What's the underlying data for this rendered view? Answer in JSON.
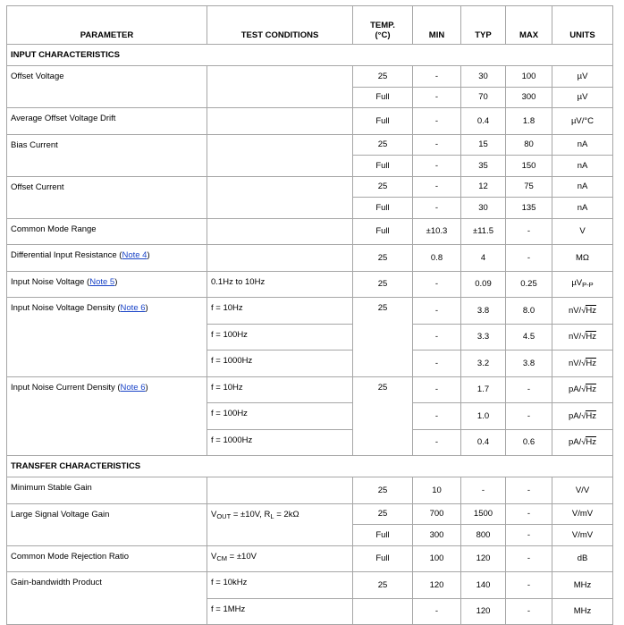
{
  "headers": {
    "parameter": "PARAMETER",
    "test_conditions": "TEST CONDITIONS",
    "temp_line1": "TEMP.",
    "temp_line2": "(°C)",
    "min": "MIN",
    "typ": "TYP",
    "max": "MAX",
    "units": "UNITS"
  },
  "sections": {
    "input": "INPUT CHARACTERISTICS",
    "transfer": "TRANSFER CHARACTERISTICS"
  },
  "params": {
    "offset_voltage": "Offset Voltage",
    "avg_offset_drift": "Average Offset Voltage Drift",
    "bias_current": "Bias Current",
    "offset_current": "Offset Current",
    "cm_range": "Common Mode Range",
    "diff_input_res": "Differential Input Resistance",
    "input_noise_voltage": "Input Noise Voltage",
    "input_noise_voltage_density": "Input Noise Voltage Density",
    "input_noise_current_density": "Input Noise Current Density",
    "min_stable_gain": "Minimum Stable Gain",
    "large_signal_gain": "Large Signal Voltage Gain",
    "cmrr": "Common Mode Rejection Ratio",
    "gbw": "Gain-bandwidth Product"
  },
  "notes": {
    "note4": "Note 4",
    "note5": "Note 5",
    "note6a": "Note 6",
    "note6b": "Note 6"
  },
  "conditions": {
    "noise_band": "0.1Hz to 10Hz",
    "f10": "f = 10Hz",
    "f100": "f = 100Hz",
    "f1000": "f = 1000Hz",
    "f10b": "f = 10Hz",
    "f100b": "f = 100Hz",
    "f1000b": "f = 1000Hz",
    "vout_pre": "V",
    "vout_sub": "OUT",
    "vout_post": " = ±10V, R",
    "rl_sub": "L",
    "rl_post": " = 2kΩ",
    "vcm_pre": "V",
    "vcm_sub": "CM",
    "vcm_post": " = ±10V",
    "f10k": "f = 10kHz",
    "f1M": "f = 1MHz"
  },
  "rows": {
    "ov1": {
      "temp": "25",
      "min": "-",
      "typ": "30",
      "max": "100",
      "unit": "µV"
    },
    "ov2": {
      "temp": "Full",
      "min": "-",
      "typ": "70",
      "max": "300",
      "unit": "µV"
    },
    "drift": {
      "temp": "Full",
      "min": "-",
      "typ": "0.4",
      "max": "1.8",
      "unit": "µV/°C"
    },
    "bc1": {
      "temp": "25",
      "min": "-",
      "typ": "15",
      "max": "80",
      "unit": "nA"
    },
    "bc2": {
      "temp": "Full",
      "min": "-",
      "typ": "35",
      "max": "150",
      "unit": "nA"
    },
    "oc1": {
      "temp": "25",
      "min": "-",
      "typ": "12",
      "max": "75",
      "unit": "nA"
    },
    "oc2": {
      "temp": "Full",
      "min": "-",
      "typ": "30",
      "max": "135",
      "unit": "nA"
    },
    "cmr": {
      "temp": "Full",
      "min": "±10.3",
      "typ": "±11.5",
      "max": "-",
      "unit": "V"
    },
    "dir": {
      "temp": "25",
      "min": "0.8",
      "typ": "4",
      "max": "-",
      "unit": "MΩ"
    },
    "inv": {
      "temp": "25",
      "min": "-",
      "typ": "0.09",
      "max": "0.25",
      "unit_pre": "µV",
      "unit_sub": "P-P"
    },
    "invd1": {
      "temp": "25",
      "min": "-",
      "typ": "3.8",
      "max": "8.0",
      "unit_pre": "nV/",
      "unit_rad": "Hz"
    },
    "invd2": {
      "min": "-",
      "typ": "3.3",
      "max": "4.5",
      "unit_pre": "nV/",
      "unit_rad": "Hz"
    },
    "invd3": {
      "min": "-",
      "typ": "3.2",
      "max": "3.8",
      "unit_pre": "nV/",
      "unit_rad": "Hz"
    },
    "incd1": {
      "temp": "25",
      "min": "-",
      "typ": "1.7",
      "max": "-",
      "unit_pre": "pA/",
      "unit_rad": "Hz"
    },
    "incd2": {
      "min": "-",
      "typ": "1.0",
      "max": "-",
      "unit_pre": "pA/",
      "unit_rad": "Hz"
    },
    "incd3": {
      "min": "-",
      "typ": "0.4",
      "max": "0.6",
      "unit_pre": "pA/",
      "unit_rad": "Hz"
    },
    "msg": {
      "temp": "25",
      "min": "10",
      "typ": "-",
      "max": "-",
      "unit": "V/V"
    },
    "lsg1": {
      "temp": "25",
      "min": "700",
      "typ": "1500",
      "max": "-",
      "unit": "V/mV"
    },
    "lsg2": {
      "temp": "Full",
      "min": "300",
      "typ": "800",
      "max": "-",
      "unit": "V/mV"
    },
    "cmrr": {
      "temp": "Full",
      "min": "100",
      "typ": "120",
      "max": "-",
      "unit": "dB"
    },
    "gbw1": {
      "temp": "25",
      "min": "120",
      "typ": "140",
      "max": "-",
      "unit": "MHz"
    },
    "gbw2": {
      "min": "-",
      "typ": "120",
      "max": "-",
      "unit": "MHz"
    }
  }
}
